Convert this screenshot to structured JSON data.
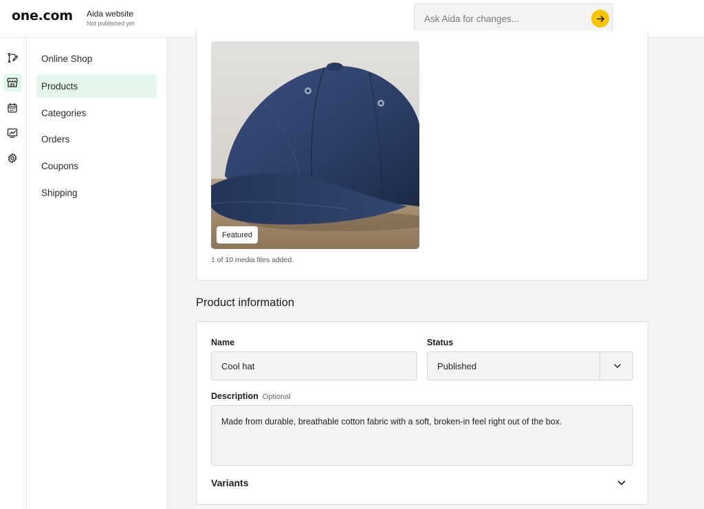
{
  "header": {
    "logo": "one.com",
    "site_title": "Aida website",
    "site_status": "Not published yet",
    "aida": {
      "placeholder": "Ask Aida for changes...",
      "send_icon": "arrow-right-icon",
      "accent": "#f7c400"
    }
  },
  "rail": {
    "items": [
      {
        "icon": "edit-site-icon",
        "active": false
      },
      {
        "icon": "shop-icon",
        "active": true
      },
      {
        "icon": "calendar-icon",
        "active": false
      },
      {
        "icon": "analytics-icon",
        "active": false
      },
      {
        "icon": "gear-icon",
        "active": false
      }
    ]
  },
  "subnav": {
    "items": [
      {
        "label": "Online Shop",
        "active": false
      },
      {
        "label": "Products",
        "active": true
      },
      {
        "label": "Categories",
        "active": false
      },
      {
        "label": "Orders",
        "active": false
      },
      {
        "label": "Coupons",
        "active": false
      },
      {
        "label": "Shipping",
        "active": false
      }
    ],
    "active_bg": "#e2f6ec"
  },
  "media": {
    "featured_label": "Featured",
    "count_text": "1 of 10 media files added."
  },
  "product_info": {
    "title": "Product information",
    "name_label": "Name",
    "name_value": "Cool hat",
    "status_label": "Status",
    "status_value": "Published",
    "description_label": "Description",
    "description_optional": "Optional",
    "description_value": "Made from durable, breathable cotton fabric with a soft, broken-in feel right out of the box.",
    "variants_label": "Variants"
  }
}
